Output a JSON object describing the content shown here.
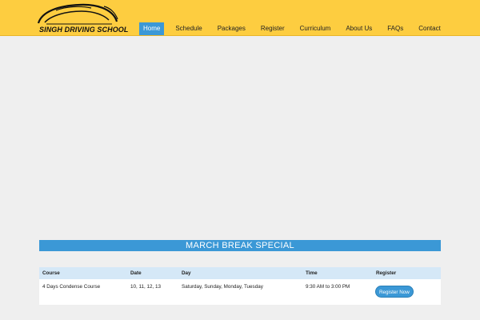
{
  "brand": {
    "name": "SINGH DRIVING SCHOOL"
  },
  "nav": {
    "items": [
      {
        "label": "Home",
        "active": true
      },
      {
        "label": "Schedule",
        "active": false
      },
      {
        "label": "Packages",
        "active": false
      },
      {
        "label": "Register",
        "active": false
      },
      {
        "label": "Curriculum",
        "active": false
      },
      {
        "label": "About Us",
        "active": false
      },
      {
        "label": "FAQs",
        "active": false
      },
      {
        "label": "Contact",
        "active": false
      }
    ]
  },
  "banner": {
    "title": "MARCH BREAK SPECIAL"
  },
  "schedule": {
    "headers": [
      "Course",
      "Date",
      "Day",
      "Time",
      "Register"
    ],
    "rows": [
      {
        "course": "4 Days Condense Course",
        "date": "10, 11, 12, 13",
        "day": "Saturday, Sunday, Monday, Tuesday",
        "time": "9:30 AM to 3:00 PM",
        "register_label": "Register Now"
      }
    ]
  },
  "colors": {
    "topbar": "#fdcd40",
    "accent": "#3b98d6",
    "background": "#efefef"
  },
  "icons": {
    "logo": "car-silhouette-icon"
  }
}
